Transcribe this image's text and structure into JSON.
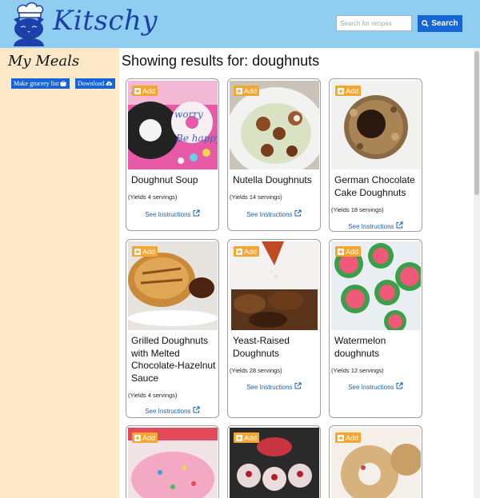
{
  "header": {
    "brand": "Kitschy",
    "search_placeholder": "Search for recipes",
    "search_button": "Search"
  },
  "sidebar": {
    "title": "My Meals",
    "grocery_button": "Make grocery list",
    "download_button": "Download"
  },
  "main": {
    "heading": "Showing results for: doughnuts",
    "add_label": "Add",
    "instructions_label": "See Instructions",
    "recipes": [
      {
        "title": "Doughnut Soup",
        "yields": "(Yields 4 servings)"
      },
      {
        "title": "Nutella Doughnuts",
        "yields": "(Yields 14 servings)"
      },
      {
        "title": "German Chocolate Cake Doughnuts",
        "yields": "(Yields 18 servings)"
      },
      {
        "title": "Grilled Doughnuts with Melted Chocolate-Hazelnut Sauce",
        "yields": "(Yields 4 servings)"
      },
      {
        "title": "Yeast-Raised Doughnuts",
        "yields": "(Yields 28 servings)"
      },
      {
        "title": "Watermelon doughnuts",
        "yields": "(Yields 12 servings)"
      },
      {
        "title": "",
        "yields": ""
      },
      {
        "title": "",
        "yields": ""
      },
      {
        "title": "",
        "yields": ""
      }
    ]
  },
  "colors": {
    "header_bg": "#8fcdf1",
    "sidebar_bg": "#fde9c8",
    "primary_button": "#1565d8",
    "add_badge": "#f7a531",
    "link": "#1a62b8",
    "brand": "#1d3fa8"
  },
  "icons": {
    "search": "search-icon",
    "basket": "basket-icon",
    "cloud_download": "cloud-download-icon",
    "plus": "plus-square-icon",
    "external_link": "external-link-icon",
    "logo": "cat-chef-logo"
  }
}
